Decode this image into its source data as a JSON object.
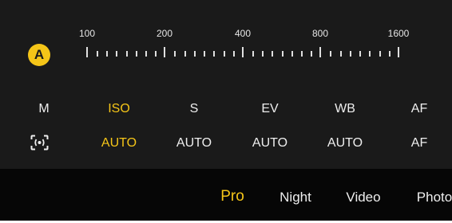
{
  "colors": {
    "accent": "#f5c518",
    "text": "#eeeeee",
    "panel_bg": "#1a1a1a",
    "mode_bar_bg": "#060606"
  },
  "exposure_badge": {
    "label": "A"
  },
  "iso_ruler": {
    "labels": [
      "100",
      "200",
      "400",
      "800",
      "1600"
    ]
  },
  "parameters": [
    {
      "label": "M",
      "value_icon": "metering-icon",
      "active": false
    },
    {
      "label": "ISO",
      "value": "AUTO",
      "active": true
    },
    {
      "label": "S",
      "value": "AUTO",
      "active": false
    },
    {
      "label": "EV",
      "value": "AUTO",
      "active": false
    },
    {
      "label": "WB",
      "value": "AUTO",
      "active": false
    },
    {
      "label": "AF",
      "value": "AF",
      "active": false
    }
  ],
  "modes": [
    {
      "label": "Pro",
      "active": true
    },
    {
      "label": "Night",
      "active": false
    },
    {
      "label": "Video",
      "active": false
    },
    {
      "label": "Photo",
      "active": false
    }
  ]
}
